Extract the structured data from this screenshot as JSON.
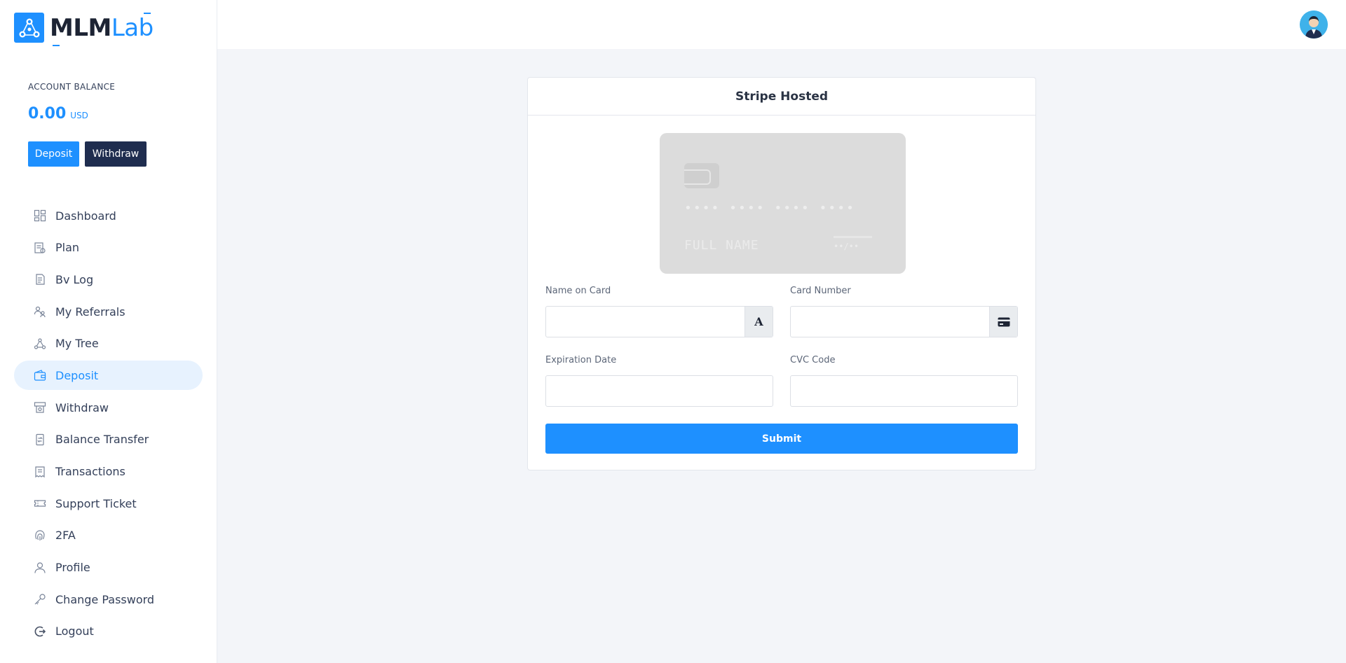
{
  "brand": {
    "name_bold": "MLM",
    "name_light": "Lab",
    "color": "#1e90ff"
  },
  "account": {
    "balance_label": "ACCOUNT BALANCE",
    "balance_amount": "0.00",
    "balance_currency": "USD",
    "deposit_label": "Deposit",
    "withdraw_label": "Withdraw"
  },
  "sidebar": {
    "items": [
      {
        "label": "Dashboard",
        "icon": "dashboard-icon"
      },
      {
        "label": "Plan",
        "icon": "plan-icon"
      },
      {
        "label": "Bv Log",
        "icon": "bv-log-icon"
      },
      {
        "label": "My Referrals",
        "icon": "referrals-icon"
      },
      {
        "label": "My Tree",
        "icon": "tree-icon"
      },
      {
        "label": "Deposit",
        "icon": "wallet-icon",
        "active": true
      },
      {
        "label": "Withdraw",
        "icon": "withdraw-icon"
      },
      {
        "label": "Balance Transfer",
        "icon": "balance-transfer-icon"
      },
      {
        "label": "Transactions",
        "icon": "transactions-icon"
      },
      {
        "label": "Support Ticket",
        "icon": "ticket-icon"
      },
      {
        "label": "2FA",
        "icon": "fingerprint-icon"
      },
      {
        "label": "Profile",
        "icon": "user-icon"
      },
      {
        "label": "Change Password",
        "icon": "key-icon"
      },
      {
        "label": "Logout",
        "icon": "logout-icon"
      }
    ]
  },
  "header": {
    "avatar_icon": "user-avatar-icon"
  },
  "payment": {
    "title": "Stripe Hosted",
    "card_preview": {
      "number": "•••• •••• •••• ••••",
      "name": "FULL NAME",
      "expiry": "••/••"
    },
    "fields": {
      "name_label": "Name on Card",
      "name_value": "",
      "name_addon": "A",
      "number_label": "Card Number",
      "number_value": "",
      "expiry_label": "Expiration Date",
      "expiry_value": "",
      "cvc_label": "CVC Code",
      "cvc_value": ""
    },
    "submit_label": "Submit"
  }
}
